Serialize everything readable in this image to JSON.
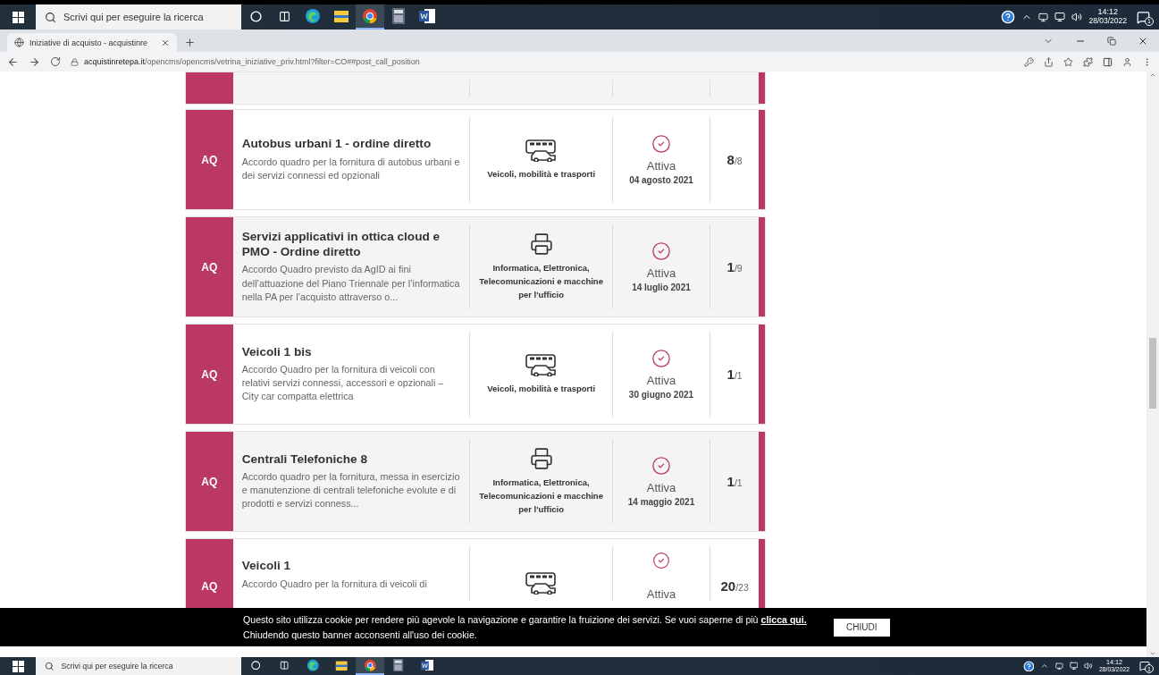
{
  "top_taskbar": {
    "search_placeholder": "Scrivi qui per eseguire la ricerca",
    "time": "14:12",
    "date": "28/03/2022",
    "notifications": "1"
  },
  "browser": {
    "tabs": [
      {
        "title": "Iniziative di acquisto - acquistinre",
        "selected": true
      }
    ],
    "address": {
      "domain": "acquistinretepa.it",
      "path": "/opencms/opencms/vetrina_iniziative_priv.html?filter=CO##post_call_position"
    }
  },
  "initiatives": [
    {
      "badge": "AQ",
      "title": "Autobus urbani 1 - ordine diretto",
      "description": "Accordo quadro per la fornitura di autobus urbani e dei servizi connessi ed opzionali",
      "kind": "vehicles",
      "category": "Veicoli, mobilità e trasporti",
      "status": "Attiva",
      "date": "04 agosto 2021",
      "count": "8",
      "total": "/8"
    },
    {
      "badge": "AQ",
      "title": "Servizi applicativi in ottica cloud e PMO - Ordine diretto",
      "description": "Accordo Quadro previsto da AgID ai fini dell’attuazione del Piano Triennale per l’informatica nella PA per l’acquisto attraverso o...",
      "kind": "office",
      "category": "Informatica, Elettronica, Telecomunicazioni e macchine per l'ufficio",
      "status": "Attiva",
      "date": "14 luglio 2021",
      "count": "1",
      "total": "/9"
    },
    {
      "badge": "AQ",
      "title": "Veicoli 1 bis",
      "description": "Accordo Quadro per la fornitura di veicoli con relativi servizi connessi, accessori e opzionali – City car compatta elettrica",
      "kind": "vehicles",
      "category": "Veicoli, mobilità e trasporti",
      "status": "Attiva",
      "date": "30 giugno 2021",
      "count": "1",
      "total": "/1"
    },
    {
      "badge": "AQ",
      "title": "Centrali Telefoniche 8",
      "description": "Accordo quadro per la fornitura, messa in esercizio e manutenzione di centrali telefoniche evolute e di prodotti e servizi conness...",
      "kind": "office",
      "category": "Informatica, Elettronica, Telecomunicazioni e macchine per l'ufficio",
      "status": "Attiva",
      "date": "14 maggio 2021",
      "count": "1",
      "total": "/1"
    },
    {
      "badge": "AQ",
      "title": "Veicoli 1",
      "description": "Accordo Quadro per la fornitura di veicoli di",
      "kind": "vehicles",
      "status": "Attiva",
      "count": "20",
      "total": "/23"
    }
  ],
  "cookie_banner": {
    "text": "Questo sito utilizza cookie per rendere più agevole la navigazione e garantire la fruizione dei servizi. Se vuoi saperne di più",
    "link": "clicca qui.",
    "text_2": "Chiudendo questo banner acconsenti all'uso dei cookie.",
    "button": "CHIUDI"
  },
  "bottom_taskbar": {
    "search_placeholder": "Scrivi qui per eseguire la ricerca",
    "time": "14:12",
    "date": "28/03/2022",
    "notifications": "1"
  }
}
